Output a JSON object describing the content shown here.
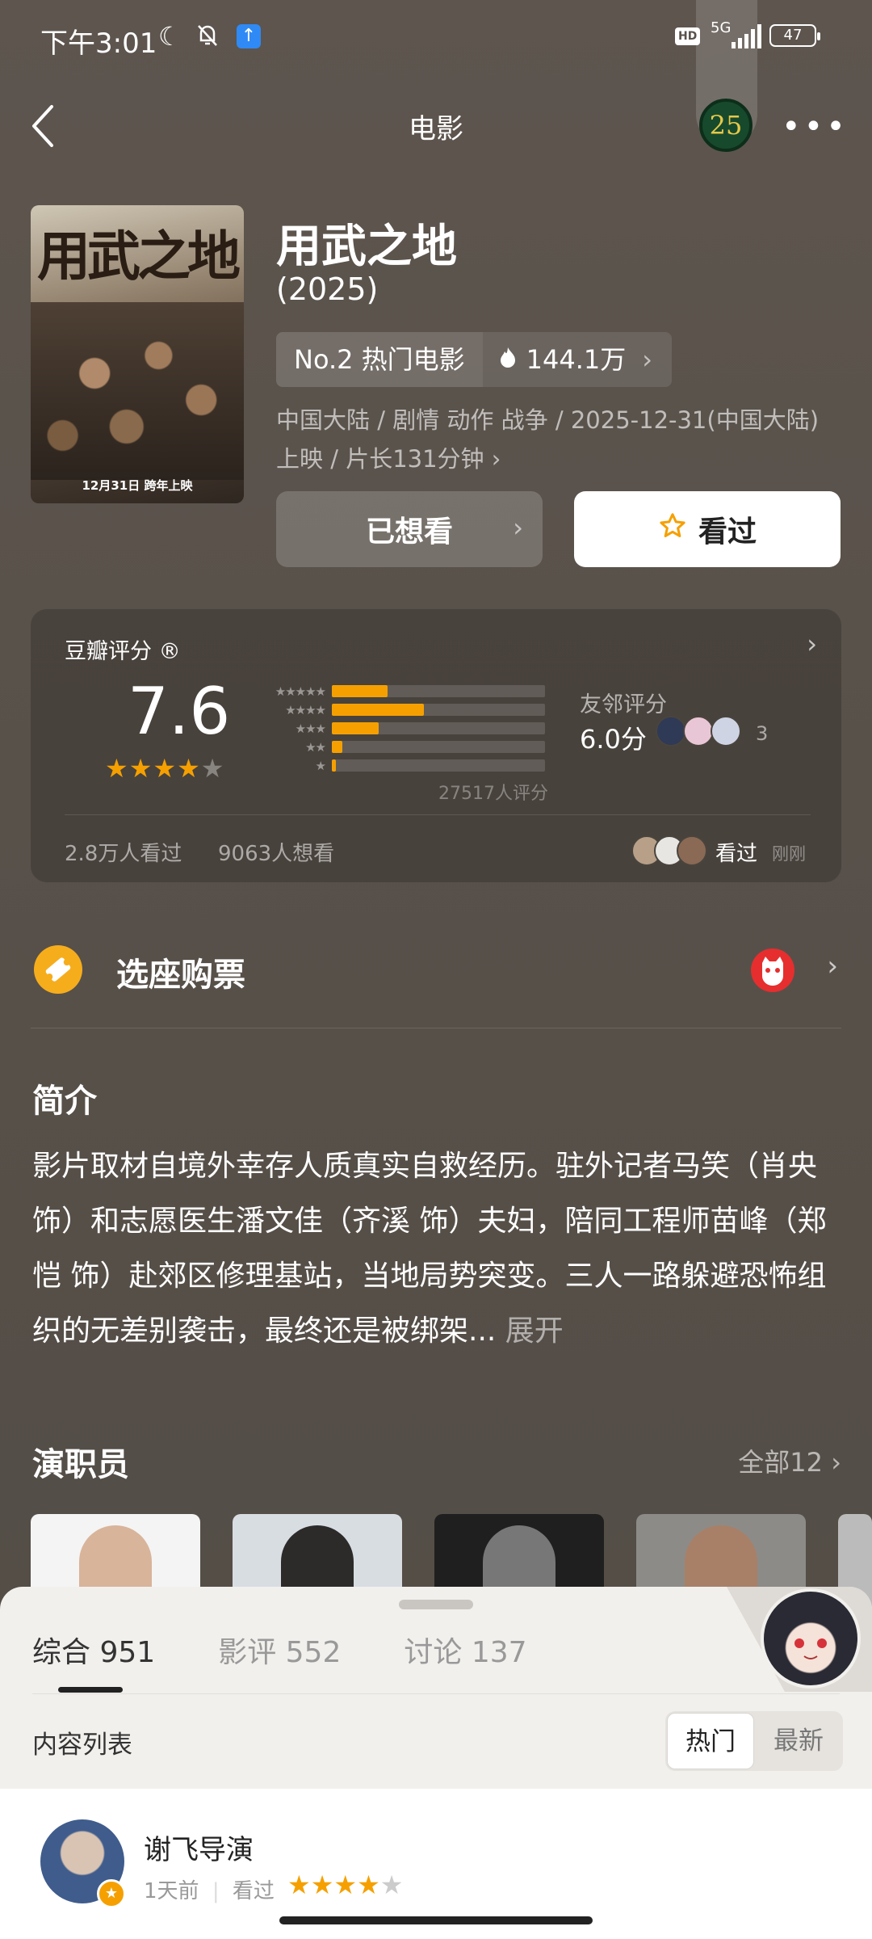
{
  "status": {
    "time": "下午3:01",
    "network": "5G",
    "battery": "47",
    "hd": "HD"
  },
  "nav": {
    "title": "电影",
    "badge": "25",
    "more": "•••"
  },
  "movie": {
    "title": "用武之地",
    "year": "(2025)",
    "poster_title": "用武之地",
    "poster_date": "12月31日 跨年上映",
    "rank_label": "No.2 热门电影",
    "heat": "144.1万",
    "meta": "中国大陆 / 剧情 动作 战争 / 2025-12-31(中国大陆)上映 / 片长131分钟 ›"
  },
  "actions": {
    "want_label": "已想看",
    "seen_label": "看过"
  },
  "rating": {
    "label": "豆瓣评分 ®",
    "score": "7.6",
    "star_fraction": 0.76,
    "distribution": [
      {
        "stars": "★★★★★",
        "pct": 0.26
      },
      {
        "stars": "★★★★",
        "pct": 0.43
      },
      {
        "stars": "★★★",
        "pct": 0.22
      },
      {
        "stars": "★★",
        "pct": 0.05
      },
      {
        "stars": "★",
        "pct": 0.02
      }
    ],
    "count_text": "27517人评分",
    "neighbor_label": "友邻评分",
    "neighbor_score": "6.0分",
    "neighbor_count": "3",
    "seen_count": "2.8万人看过",
    "wish_count": "9063人想看",
    "friends_seen": "看过",
    "friends_time": "刚刚"
  },
  "ticket": {
    "label": "选座购票"
  },
  "synopsis": {
    "title": "简介",
    "text": "影片取材自境外幸存人质真实自救经历。驻外记者马笑（肖央 饰）和志愿医生潘文佳（齐溪 饰）夫妇，陪同工程师苗峰（郑恺 饰）赴郊区修理基站，当地局势突变。三人一路躲避恐怖组织的无差别袭击，最终还是被绑架...",
    "expand": "展开"
  },
  "cast": {
    "title": "演职员",
    "all": "全部12 ›"
  },
  "sheet": {
    "tabs": [
      {
        "label": "综合",
        "count": "951"
      },
      {
        "label": "影评",
        "count": "552"
      },
      {
        "label": "讨论",
        "count": "137"
      }
    ],
    "list_label": "内容列表",
    "sort_hot": "热门",
    "sort_new": "最新"
  },
  "post": {
    "author": "谢飞导演",
    "time": "1天前",
    "status": "看过",
    "rating": 4
  },
  "colors": {
    "accent": "#f5a000",
    "bg": "#58514a"
  }
}
